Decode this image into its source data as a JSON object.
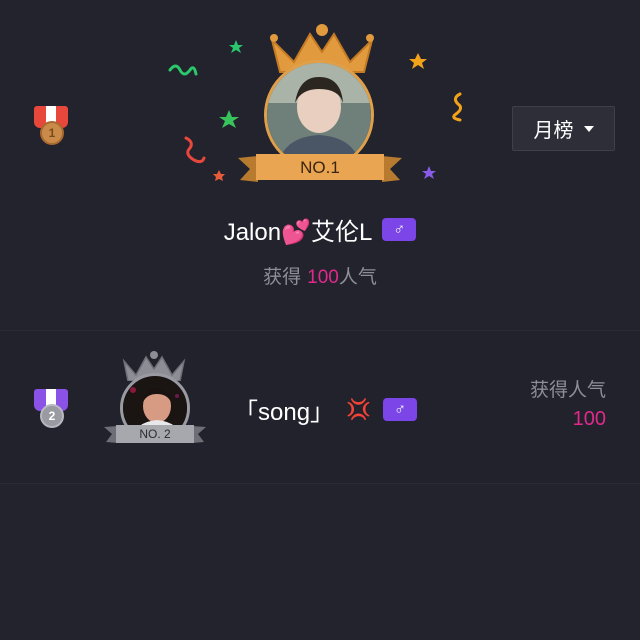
{
  "period_dropdown": {
    "label": "月榜"
  },
  "first_place": {
    "rank": "1",
    "badge": "NO.1",
    "name": "Jalon💕艾伦L",
    "gender_symbol": "♂",
    "popularity_prefix": "获得",
    "popularity_value": "100",
    "popularity_suffix": "人气"
  },
  "ranking_list": [
    {
      "rank": "2",
      "badge": "NO. 2",
      "name": "「song」",
      "emoji": "💢",
      "gender_symbol": "♂",
      "popularity_label": "获得人气",
      "popularity_value": "100"
    }
  ],
  "colors": {
    "background": "#23232e",
    "accent_pink": "#e0298a",
    "gender_purple": "#7b45e8",
    "gold": "#e0a04a",
    "silver": "#a9a9b0"
  }
}
